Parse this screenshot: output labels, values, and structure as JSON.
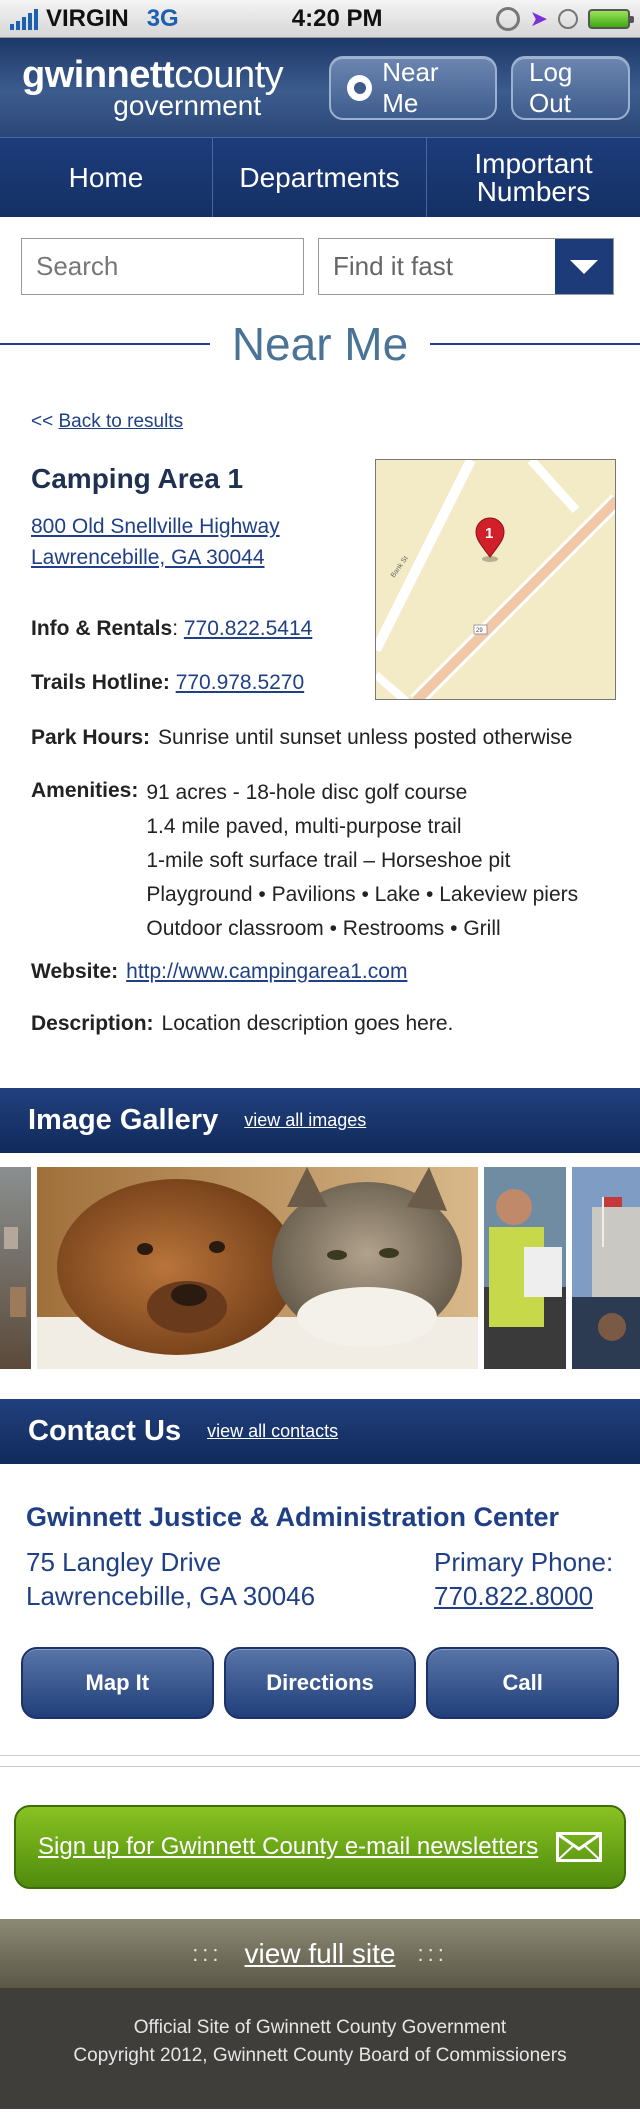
{
  "status_bar": {
    "carrier": "VIRGIN",
    "network": "3G",
    "time": "4:20 PM"
  },
  "header": {
    "logo_line1_bold": "gwinnett",
    "logo_line1_light": "county",
    "logo_line2": "government",
    "near_me_label": "Near Me",
    "logout_label": "Log Out"
  },
  "nav": {
    "items": [
      "Home",
      "Departments",
      "Important Numbers"
    ]
  },
  "search": {
    "placeholder": "Search",
    "find_fast_label": "Find it fast"
  },
  "page_title": "Near Me",
  "back": {
    "prefix": "<<",
    "label": "Back to results"
  },
  "location": {
    "name": "Camping Area 1",
    "address_line1": "800 Old Snellville Highway",
    "address_line2": "Lawrencebille, GA 30044",
    "info_label": "Info & Rentals",
    "info_phone": "770.822.5414",
    "trails_label": "Trails Hotline:",
    "trails_phone": "770.978.5270",
    "map_marker": "1",
    "map_road_label": "Bank St",
    "map_route_label": "29",
    "park_hours_label": "Park Hours:",
    "park_hours": "Sunrise until sunset unless posted otherwise",
    "amenities_label": "Amenities:",
    "amenities": [
      "91 acres - 18-hole disc golf course",
      "1.4 mile paved, multi-purpose trail",
      "1-mile soft surface trail – Horseshoe pit",
      "Playground • Pavilions • Lake • Lakeview piers",
      "Outdoor classroom • Restrooms • Grill"
    ],
    "website_label": "Website:",
    "website": "http://www.campingarea1.com",
    "description_label": "Description:",
    "description": "Location description goes here."
  },
  "gallery": {
    "title": "Image Gallery",
    "view_all": "view all images"
  },
  "contact": {
    "title": "Contact Us",
    "view_all": "view all contacts",
    "name": "Gwinnett Justice & Administration Center",
    "address_line1": "75 Langley Drive",
    "address_line2": "Lawrencebille, GA 30046",
    "phone_label": "Primary Phone:",
    "phone": "770.822.8000",
    "buttons": [
      "Map It",
      "Directions",
      "Call"
    ]
  },
  "newsletter": {
    "label": "Sign up for Gwinnett County e-mail newsletters"
  },
  "footer": {
    "separator": ":::",
    "view_full_site": "view full site",
    "line1": "Official Site of Gwinnett County Government",
    "line2": "Copyright 2012, Gwinnett County Board of Commissioners"
  },
  "colors": {
    "brand_navy": "#1c3b78",
    "title_blue": "#4a7395",
    "link_blue": "#1f3f86",
    "newsletter_green": "#6aa619",
    "footer_dark": "#403e3b"
  }
}
